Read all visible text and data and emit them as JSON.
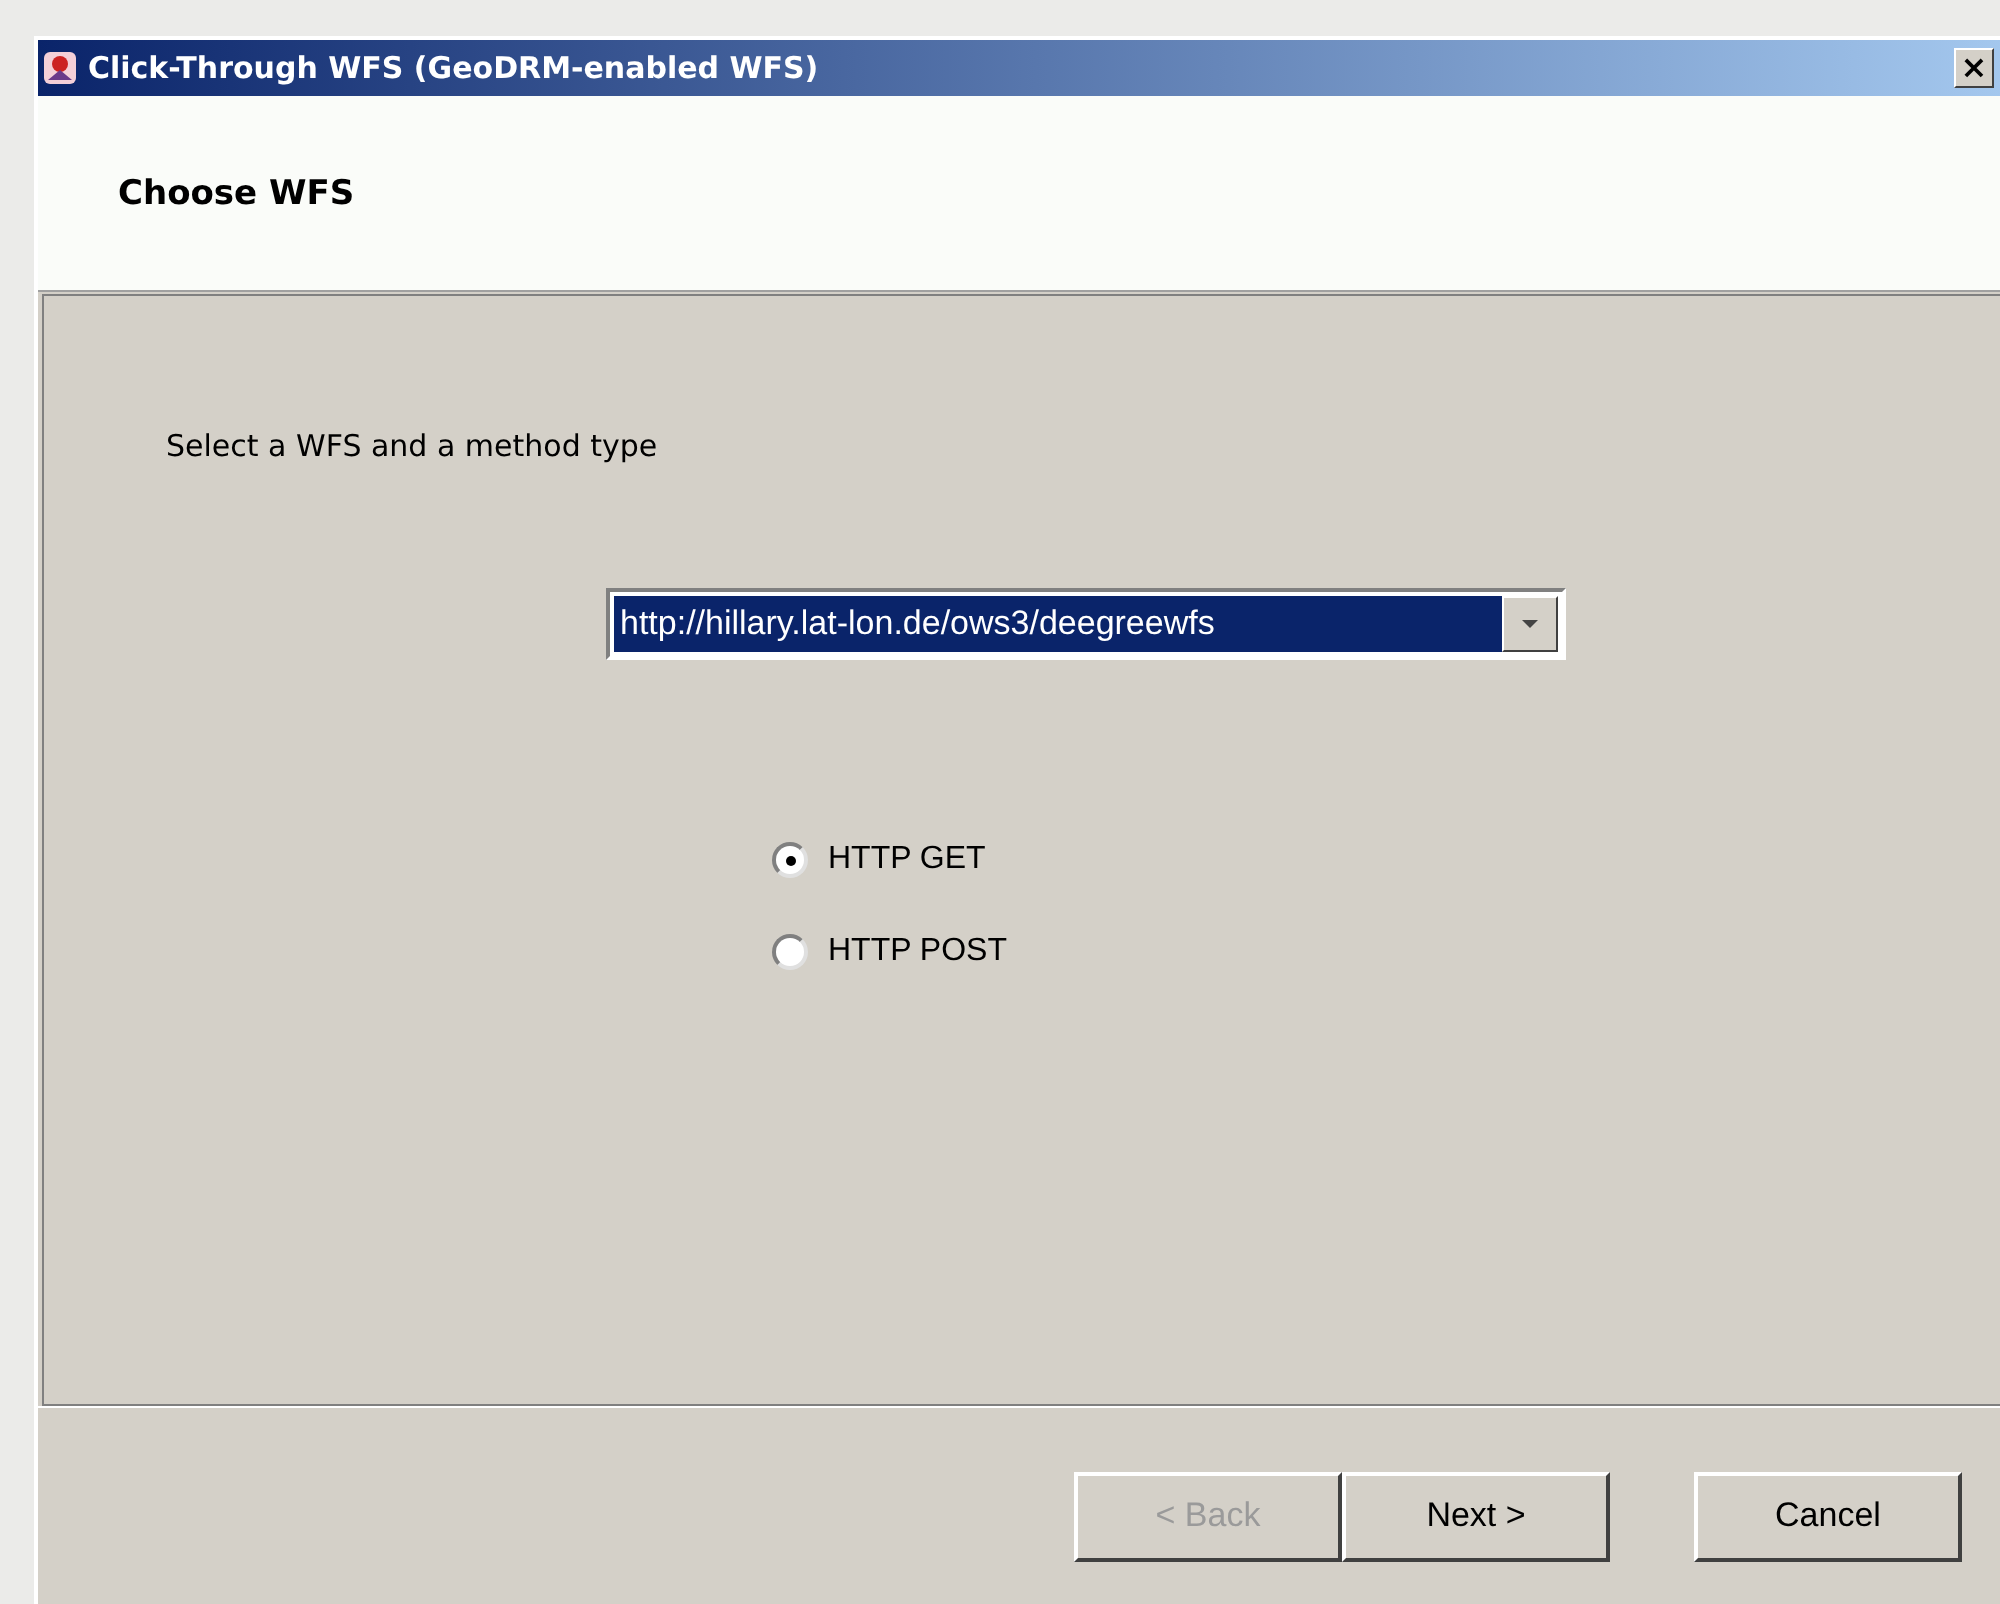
{
  "window": {
    "title": "Click-Through WFS (GeoDRM-enabled WFS)",
    "close": "×"
  },
  "header": {
    "title": "Choose WFS"
  },
  "instruction": "Select a WFS and a method type",
  "wfs_select": {
    "value": "http://hillary.lat-lon.de/ows3/deegreewfs",
    "focused": true
  },
  "methods": [
    {
      "label": "HTTP GET",
      "selected": true
    },
    {
      "label": "HTTP POST",
      "selected": false
    }
  ],
  "buttons": [
    {
      "label": "< Back",
      "disabled": true
    },
    {
      "label": "Next >",
      "disabled": false
    },
    {
      "label": "Cancel",
      "disabled": false
    }
  ]
}
